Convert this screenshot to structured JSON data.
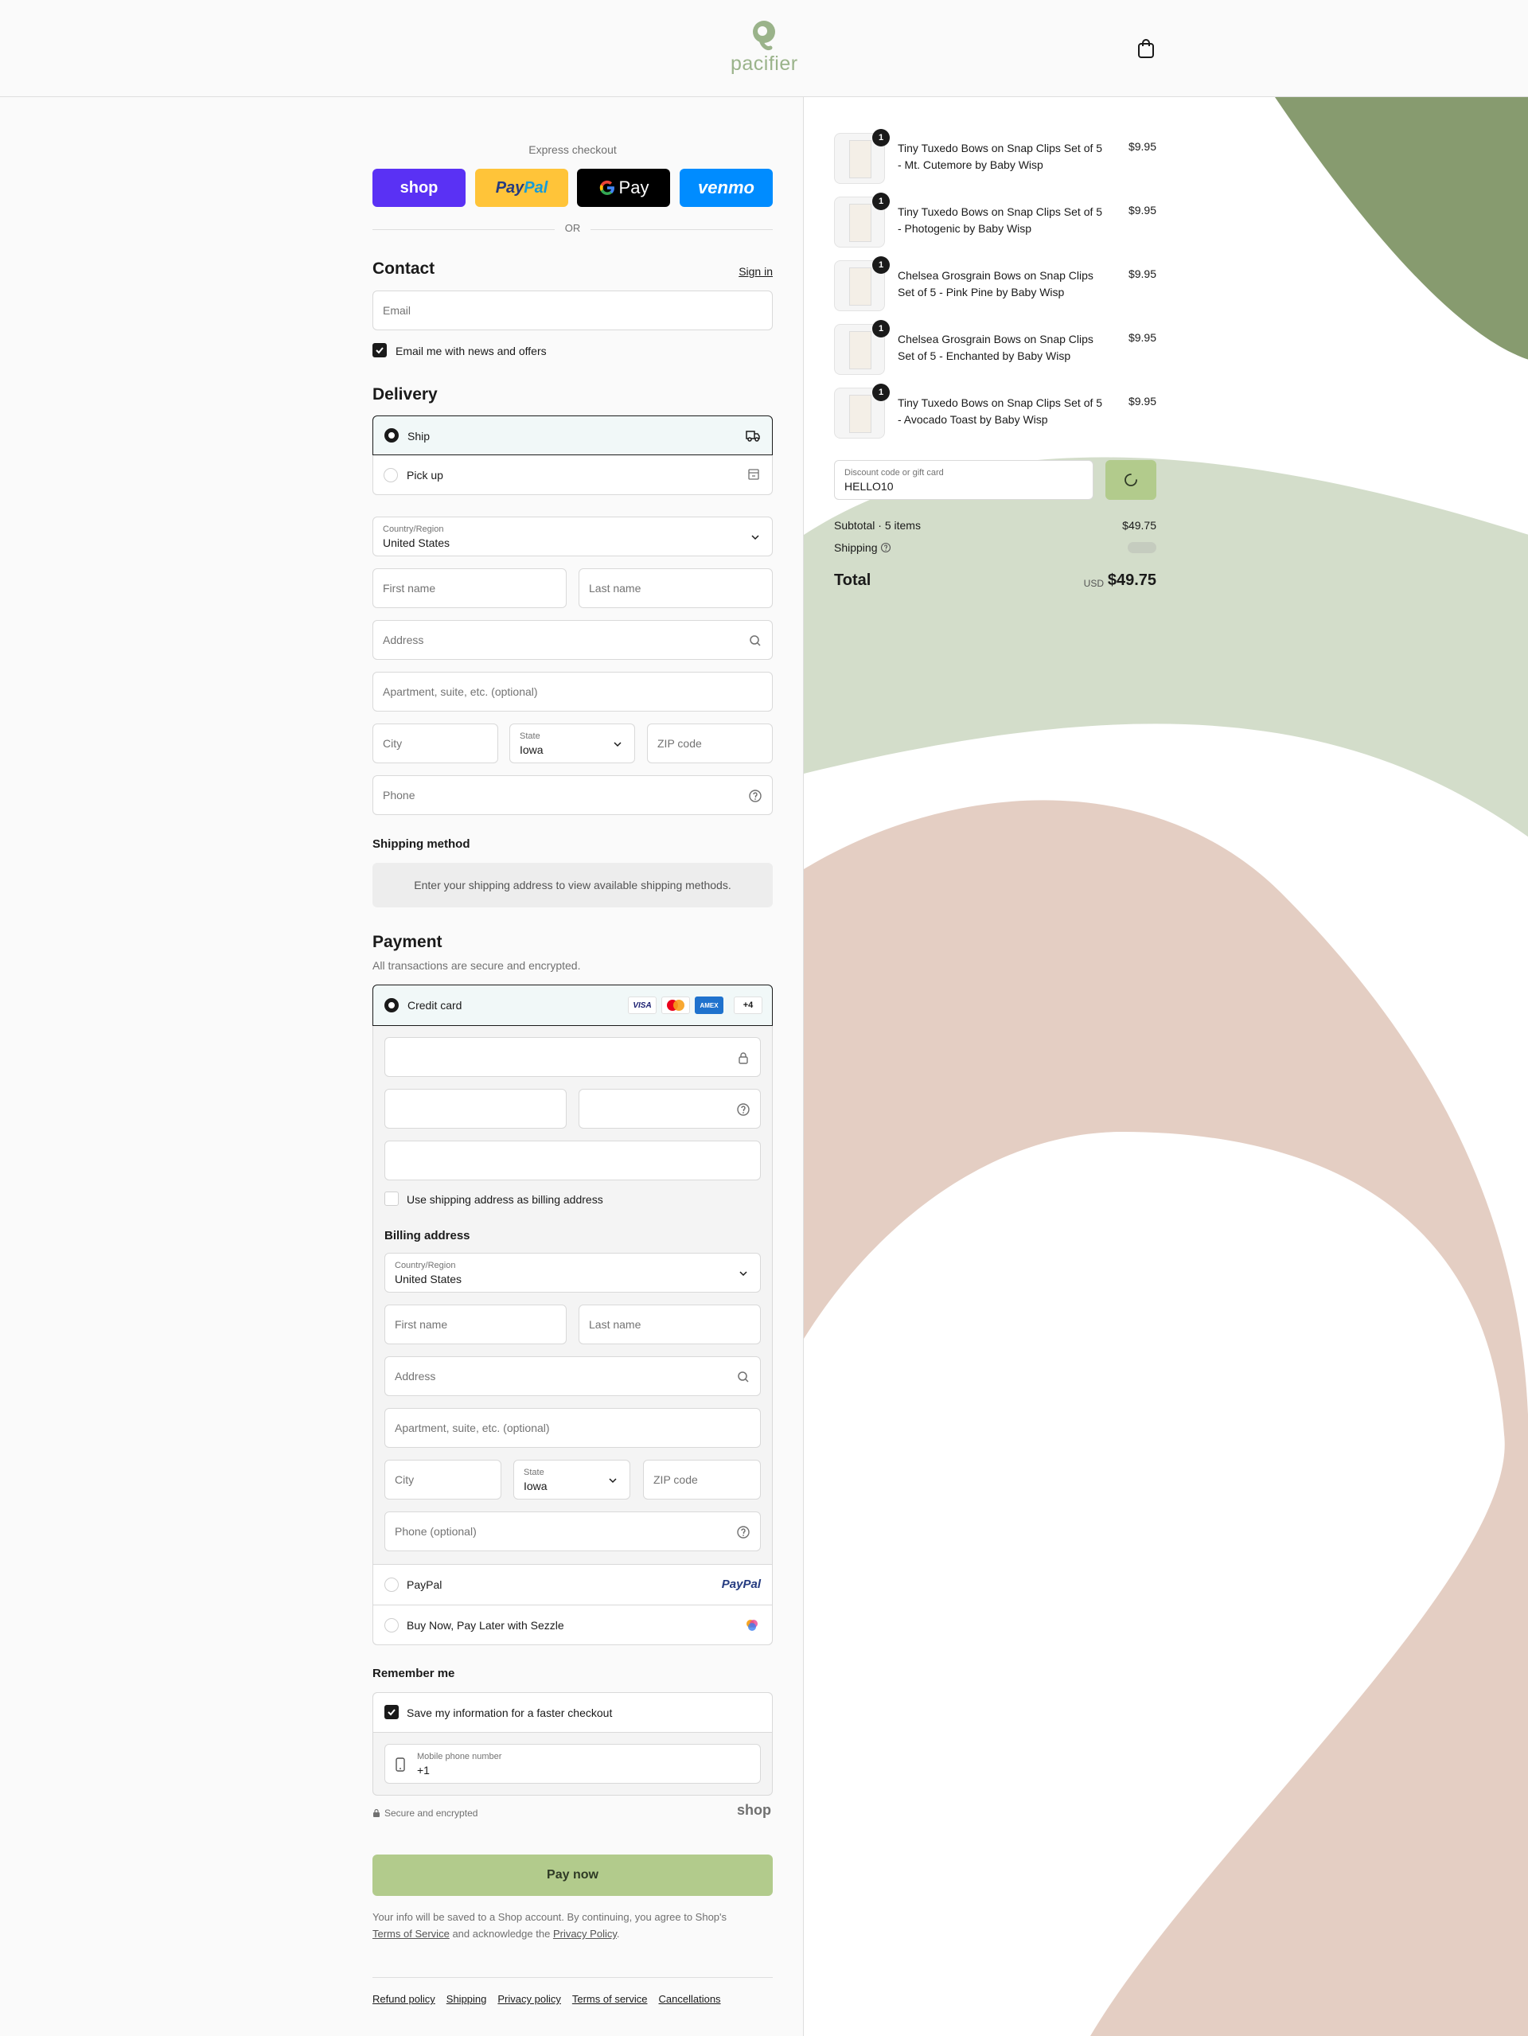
{
  "header": {
    "brand": "pacifier",
    "cart_icon": "shopping-bag-icon"
  },
  "express": {
    "label": "Express checkout",
    "shop": "shop",
    "paypal_pay": "Pay",
    "paypal_pal": "Pal",
    "gpay": "Pay",
    "venmo": "venmo",
    "or": "OR"
  },
  "contact": {
    "title": "Contact",
    "sign_in": "Sign in",
    "email_placeholder": "Email",
    "news_label": "Email me with news and offers"
  },
  "delivery": {
    "title": "Delivery",
    "ship": "Ship",
    "pickup": "Pick up",
    "country_label": "Country/Region",
    "country_value": "United States",
    "first_name": "First name",
    "last_name": "Last name",
    "address": "Address",
    "apartment": "Apartment, suite, etc. (optional)",
    "city": "City",
    "state_label": "State",
    "state_value": "Iowa",
    "zip": "ZIP code",
    "phone": "Phone"
  },
  "shipping_method": {
    "title": "Shipping method",
    "message": "Enter your shipping address to view available shipping methods."
  },
  "payment": {
    "title": "Payment",
    "subtitle": "All transactions are secure and encrypted.",
    "credit_card": "Credit card",
    "cards": [
      "VISA",
      "",
      "AMEX"
    ],
    "more_cards": "+4",
    "use_shipping": "Use shipping address as billing address",
    "billing_title": "Billing address",
    "billing_country_label": "Country/Region",
    "billing_country_value": "United States",
    "billing_first_name": "First name",
    "billing_last_name": "Last name",
    "billing_address": "Address",
    "billing_apartment": "Apartment, suite, etc. (optional)",
    "billing_city": "City",
    "billing_state_label": "State",
    "billing_state_value": "Iowa",
    "billing_zip": "ZIP code",
    "billing_phone": "Phone (optional)",
    "paypal": "PayPal",
    "paypal_logo": "PayPal",
    "sezzle": "Buy Now, Pay Later with Sezzle"
  },
  "remember": {
    "title": "Remember me",
    "save_label": "Save my information for a faster checkout",
    "mobile_label": "Mobile phone number",
    "mobile_value": "+1",
    "secure": "Secure and encrypted",
    "shop_logo": "shop"
  },
  "pay": {
    "button": "Pay now",
    "info_1": "Your info will be saved to a Shop account. By continuing, you agree to Shop's",
    "terms": "Terms of Service",
    "info_2": "and acknowledge the",
    "privacy": "Privacy Policy",
    "info_3": "."
  },
  "footer_links": [
    "Refund policy",
    "Shipping",
    "Privacy policy",
    "Terms of service",
    "Cancellations"
  ],
  "summary": {
    "items": [
      {
        "qty": "1",
        "name": "Tiny Tuxedo Bows on Snap Clips Set of 5 - Mt. Cutemore by Baby Wisp",
        "price": "$9.95"
      },
      {
        "qty": "1",
        "name": "Tiny Tuxedo Bows on Snap Clips Set of 5 - Photogenic by Baby Wisp",
        "price": "$9.95"
      },
      {
        "qty": "1",
        "name": "Chelsea Grosgrain Bows on Snap Clips Set of 5 - Pink Pine by Baby Wisp",
        "price": "$9.95"
      },
      {
        "qty": "1",
        "name": "Chelsea Grosgrain Bows on Snap Clips Set of 5 - Enchanted by Baby Wisp",
        "price": "$9.95"
      },
      {
        "qty": "1",
        "name": "Tiny Tuxedo Bows on Snap Clips Set of 5 - Avocado Toast by Baby Wisp",
        "price": "$9.95"
      }
    ],
    "discount_label": "Discount code or gift card",
    "discount_value": "HELLO10",
    "subtotal_label": "Subtotal · 5 items",
    "subtotal_value": "$49.75",
    "shipping_label": "Shipping",
    "total_label": "Total",
    "currency": "USD",
    "total_value": "$49.75"
  },
  "colors": {
    "accent_green": "#b2cb8c",
    "shop_purple": "#5a31f4",
    "paypal_yellow": "#ffc439",
    "venmo_blue": "#008cff",
    "bg_green_dark": "#879b6f",
    "bg_green_light": "#d3ddca",
    "bg_pink": "#e4cec3"
  }
}
